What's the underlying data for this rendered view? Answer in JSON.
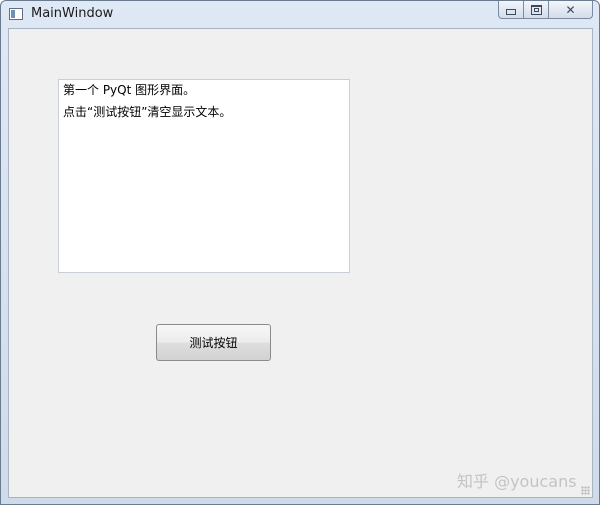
{
  "window": {
    "title": "MainWindow",
    "icon": "app-window-icon",
    "controls": {
      "minimize_icon": "minimize-icon",
      "maximize_icon": "maximize-icon",
      "close_icon": "close-icon",
      "close_glyph": "✕"
    }
  },
  "main": {
    "text_display": {
      "lines": [
        "第一个 PyQt 图形界面。",
        "点击“测试按钮”清空显示文本。"
      ]
    },
    "test_button": {
      "label": "测试按钮"
    }
  },
  "watermark": {
    "text": "知乎 @youcans"
  },
  "colors": {
    "client_background": "#f0f0f0",
    "text_area_background": "#ffffff",
    "titlebar": "#dfe9f5"
  }
}
